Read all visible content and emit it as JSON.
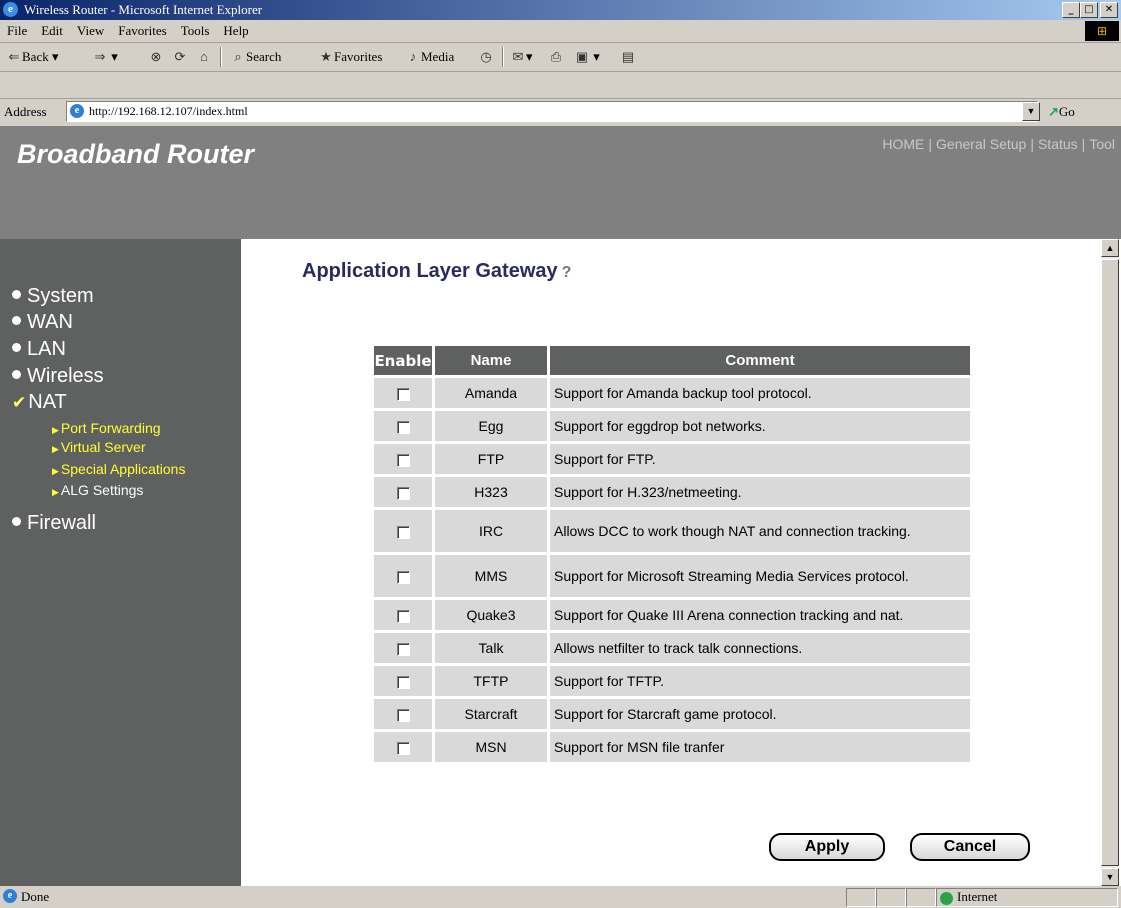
{
  "window": {
    "title": "Wireless Router - Microsoft Internet Explorer"
  },
  "menubar": {
    "items": [
      "File",
      "Edit",
      "View",
      "Favorites",
      "Tools",
      "Help"
    ]
  },
  "toolbar": {
    "back": "Back",
    "search": "Search",
    "favorites": "Favorites",
    "media": "Media"
  },
  "address": {
    "label": "Address",
    "url": "http://192.168.12.107/index.html",
    "go": "Go"
  },
  "header": {
    "brand": "Broadband Router",
    "nav": [
      "HOME",
      "General Setup",
      "Status",
      "Tool"
    ],
    "nav_sep": "|"
  },
  "sidebar": {
    "items": [
      "System",
      "WAN",
      "LAN",
      "Wireless",
      "NAT",
      "Firewall"
    ],
    "active": "NAT",
    "submenu": [
      "Port Forwarding",
      "Virtual Server",
      "Special Applications",
      "ALG Settings"
    ],
    "current_sub": "ALG Settings"
  },
  "page": {
    "title": "Application Layer Gateway"
  },
  "table": {
    "headers": [
      "Enable",
      "Name",
      "Comment"
    ],
    "rows": [
      {
        "name": "Amanda",
        "comment": "Support for Amanda backup tool protocol.",
        "checked": false
      },
      {
        "name": "Egg",
        "comment": "Support for eggdrop bot networks.",
        "checked": false
      },
      {
        "name": "FTP",
        "comment": "Support for FTP.",
        "checked": false
      },
      {
        "name": "H323",
        "comment": "Support for H.323/netmeeting.",
        "checked": false
      },
      {
        "name": "IRC",
        "comment": "Allows DCC to work though NAT and connection tracking.",
        "checked": false
      },
      {
        "name": "MMS",
        "comment": "Support for Microsoft Streaming Media Services protocol.",
        "checked": false
      },
      {
        "name": "Quake3",
        "comment": "Support for Quake III Arena connection tracking and nat.",
        "checked": false
      },
      {
        "name": "Talk",
        "comment": "Allows netfilter to track talk connections.",
        "checked": false
      },
      {
        "name": "TFTP",
        "comment": "Support for TFTP.",
        "checked": false
      },
      {
        "name": "Starcraft",
        "comment": "Support for Starcraft game protocol.",
        "checked": false
      },
      {
        "name": "MSN",
        "comment": "Support for MSN file tranfer",
        "checked": false
      }
    ]
  },
  "buttons": {
    "apply": "Apply",
    "cancel": "Cancel"
  },
  "status": {
    "text": "Done",
    "zone": "Internet"
  },
  "colors": {
    "header": "#808080",
    "sidebar": "#5f6160",
    "submenu": "#ffff33",
    "title": "#2b2a5f",
    "cell": "#d9d9d9"
  }
}
